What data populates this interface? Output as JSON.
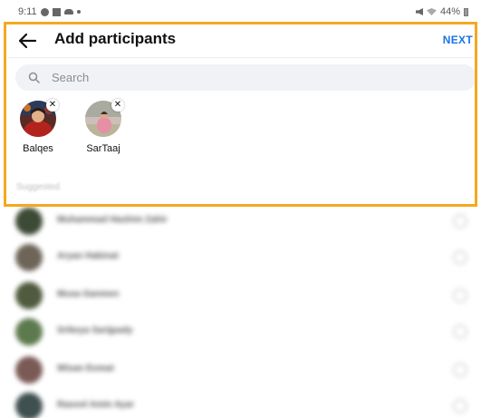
{
  "status_bar": {
    "time": "9:11",
    "battery": "44%"
  },
  "header": {
    "title": "Add participants",
    "next_label": "NEXT"
  },
  "search": {
    "placeholder": "Search"
  },
  "selected": [
    {
      "name": "Balqes"
    },
    {
      "name": "SarTaaj"
    }
  ],
  "suggested_label": "Suggested",
  "suggested": [
    {
      "name": "Muhammad Hashim Zahir"
    },
    {
      "name": "Aryan Habinat"
    },
    {
      "name": "Musa Ganmen"
    },
    {
      "name": "Srikeya Sarijpady"
    },
    {
      "name": "Wisan Eomat"
    },
    {
      "name": "Rasool Amin Ayar"
    }
  ],
  "colors": {
    "accent": "#1a73e8",
    "highlight_frame": "#f5a81f",
    "search_bg": "#f0f2f5"
  }
}
